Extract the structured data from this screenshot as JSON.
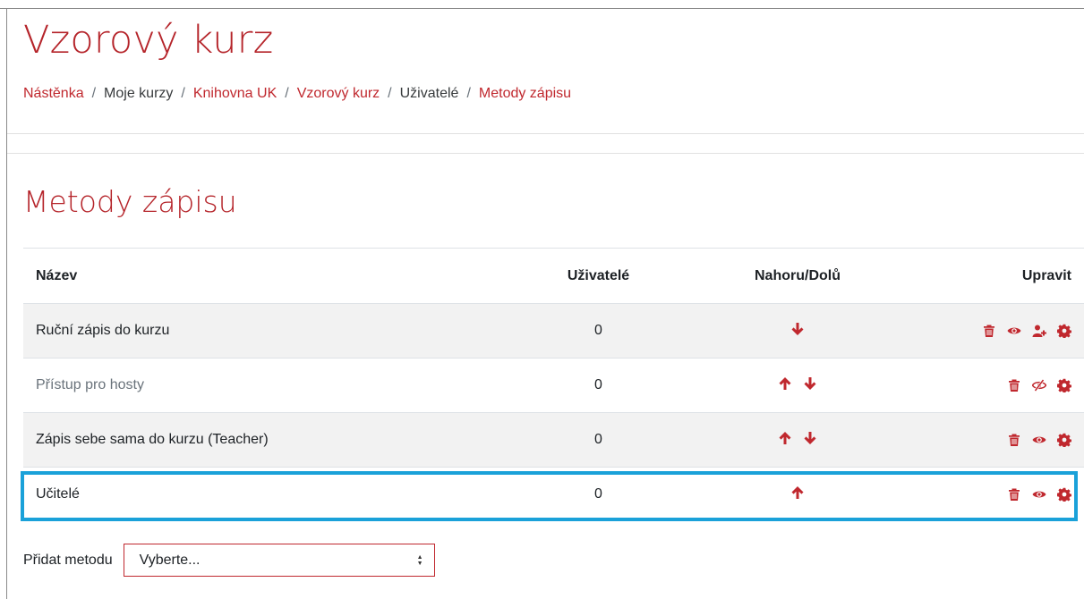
{
  "course": {
    "title": "Vzorový kurz"
  },
  "breadcrumb": [
    {
      "label": "Nástěnka",
      "link": true
    },
    {
      "label": "Moje kurzy",
      "link": false
    },
    {
      "label": "Knihovna UK",
      "link": true
    },
    {
      "label": "Vzorový kurz",
      "link": true
    },
    {
      "label": "Uživatelé",
      "link": false
    },
    {
      "label": "Metody zápisu",
      "link": true
    }
  ],
  "breadcrumb_separator": "/",
  "section": {
    "title": "Metody zápisu"
  },
  "table": {
    "headers": {
      "name": "Název",
      "users": "Uživatelé",
      "move": "Nahoru/Dolů",
      "edit": "Upravit"
    },
    "rows": [
      {
        "name": "Ruční zápis do kurzu",
        "users": "0",
        "move": [
          "down"
        ],
        "edit": [
          "delete",
          "visible",
          "enrol-users",
          "settings"
        ],
        "disabled": false
      },
      {
        "name": "Přístup pro hosty",
        "users": "0",
        "move": [
          "up",
          "down"
        ],
        "edit": [
          "delete",
          "hidden",
          "settings"
        ],
        "disabled": true
      },
      {
        "name": "Zápis sebe sama do kurzu (Teacher)",
        "users": "0",
        "move": [
          "up",
          "down"
        ],
        "edit": [
          "delete",
          "visible",
          "settings"
        ],
        "disabled": false
      },
      {
        "name": "Učitelé",
        "users": "0",
        "move": [
          "up"
        ],
        "edit": [
          "delete",
          "visible",
          "settings"
        ],
        "disabled": false
      }
    ]
  },
  "add_method": {
    "label": "Přidat metodu",
    "select_value": "Vyberte..."
  },
  "colors": {
    "brand": "#c0282e",
    "highlight": "#1aa1d9"
  }
}
